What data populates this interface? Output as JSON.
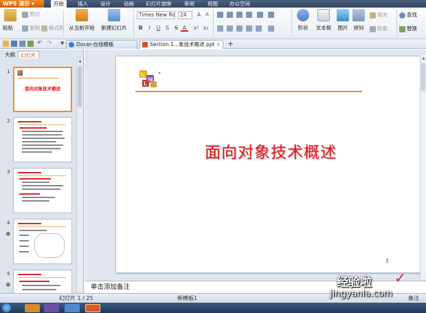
{
  "app": {
    "name": "WPS 演示"
  },
  "menu": {
    "tabs": [
      "开始",
      "插入",
      "设计",
      "动画",
      "幻灯片放映",
      "审阅",
      "视图",
      "办公空间"
    ],
    "active": "开始"
  },
  "ribbon": {
    "paste": "粘贴",
    "cut": "剪切",
    "copy": "复制",
    "format_painter": "格式刷",
    "from_current": "从当前开始",
    "new_slide": "新建幻灯片",
    "font_name": "Times New Ro",
    "font_size": "24",
    "shape": "形状",
    "textbox": "文本框",
    "picture": "图片",
    "arrange": "排列",
    "fill": "填充",
    "outline": "轮廓",
    "find": "查找",
    "replace": "替换"
  },
  "doc_tabs": [
    "Docer-在线模板",
    "Section 1...象技术概述.ppt"
  ],
  "left_pane": {
    "tabs": [
      "大纲",
      "幻灯片"
    ],
    "active": "幻灯片",
    "slide_numbers": [
      "1",
      "2",
      "3",
      "4",
      "5"
    ],
    "slide1_title": "面向对象技术概述"
  },
  "slide": {
    "title": "面向对象技术概述",
    "page_number": "1",
    "logo_letters": "UML"
  },
  "notes": {
    "placeholder": "单击添加备注"
  },
  "status": {
    "slide_index": "幻灯片 1 / 25",
    "template": "新模板1",
    "notes_label": "备注"
  },
  "watermark": {
    "brand": "经验啦",
    "url": "jingyanla.com"
  },
  "colors": {
    "accent_orange": "#f28c28",
    "title_red": "#e4151b",
    "ribbon_bg": "#e9eef4"
  }
}
